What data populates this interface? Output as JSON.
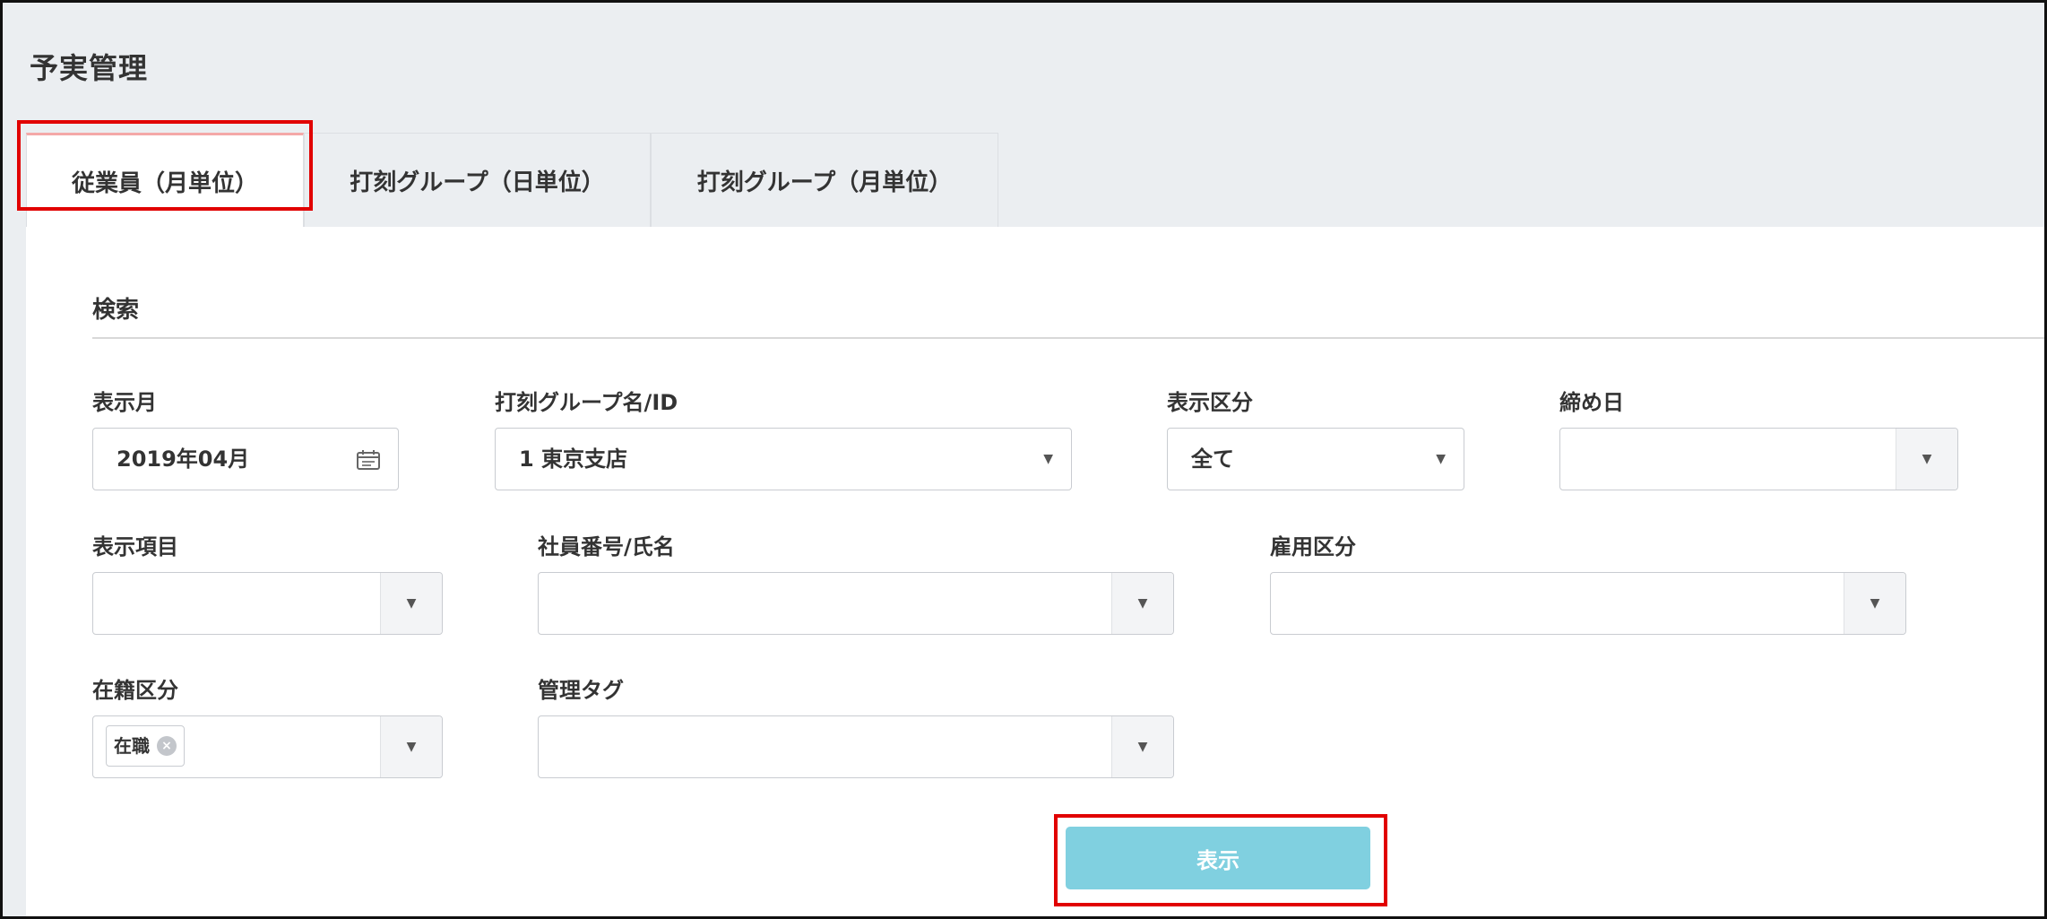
{
  "page": {
    "title": "予実管理"
  },
  "tabs": [
    {
      "label": "従業員（月単位）",
      "active": true
    },
    {
      "label": "打刻グループ（日単位）",
      "active": false
    },
    {
      "label": "打刻グループ（月単位）",
      "active": false
    }
  ],
  "search": {
    "section_title": "検索",
    "fields": {
      "display_month": {
        "label": "表示月",
        "value": "2019年04月",
        "icon": "calendar-icon"
      },
      "stamp_group": {
        "label": "打刻グループ名/ID",
        "value": "1 東京支店",
        "icon": "chevron-down-icon"
      },
      "display_type": {
        "label": "表示区分",
        "value": "全て",
        "icon": "chevron-down-icon"
      },
      "closing_day": {
        "label": "締め日",
        "value": "",
        "icon": "chevron-down-icon"
      },
      "display_items": {
        "label": "表示項目",
        "value": "",
        "icon": "chevron-down-icon"
      },
      "employee": {
        "label": "社員番号/氏名",
        "value": "",
        "icon": "chevron-down-icon"
      },
      "employment_type": {
        "label": "雇用区分",
        "value": "",
        "icon": "chevron-down-icon"
      },
      "enrollment": {
        "label": "在籍区分",
        "tags": [
          "在職"
        ],
        "icon": "chevron-down-icon"
      },
      "management_tag": {
        "label": "管理タグ",
        "value": "",
        "icon": "chevron-down-icon"
      }
    },
    "submit_label": "表示"
  },
  "colors": {
    "page_background": "#ebeef1",
    "panel_background": "#ffffff",
    "submit_button": "#80d0e0",
    "highlight_box": "#e10000",
    "active_tab_accent": "#f4a8a8"
  }
}
